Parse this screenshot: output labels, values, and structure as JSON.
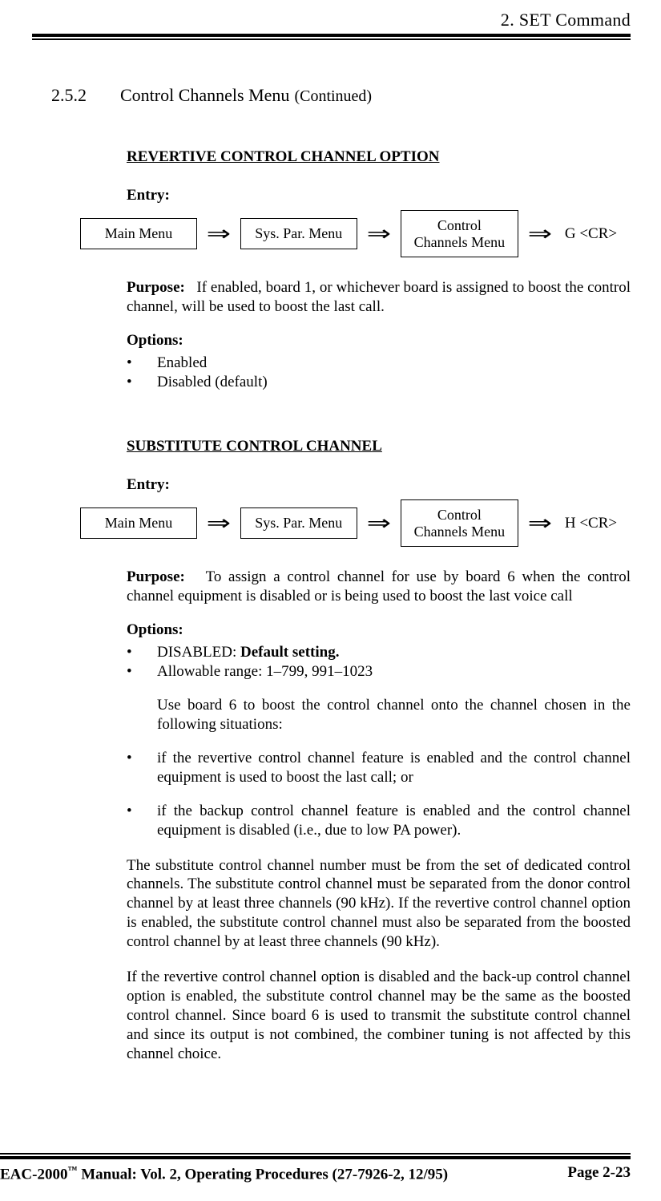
{
  "header": {
    "chapter": "2.   SET Command"
  },
  "section": {
    "number": "2.5.2",
    "title": "Control Channels Menu",
    "continued": "(Continued)"
  },
  "s1": {
    "heading": "REVERTIVE CONTROL CHANNEL OPTION",
    "entry_label": "Entry:",
    "box1": "Main Menu",
    "box2": "Sys. Par. Menu",
    "box3": "Control\nChannels Menu",
    "command": "G <CR>",
    "purpose_label": "Purpose:",
    "purpose_text": "If enabled, board 1, or whichever board is assigned to boost the control channel, will be used to boost the last call.",
    "options_label": "Options:",
    "opt1": "Enabled",
    "opt2": "Disabled (default)"
  },
  "s2": {
    "heading": "SUBSTITUTE CONTROL CHANNEL",
    "entry_label": "Entry:",
    "box1": "Main Menu",
    "box2": "Sys. Par. Menu",
    "box3": "Control\nChannels Menu",
    "command": "H <CR>",
    "purpose_label": "Purpose:",
    "purpose_text": "To assign a control channel for use by board 6 when the control channel equipment is disabled or is being used to boost the last voice call",
    "options_label": "Options:",
    "opt1_prefix": "DISABLED:  ",
    "opt1_bold": "Default setting.",
    "opt2": "Allowable range:  1–799, 991–1023",
    "opt_note": "Use board 6 to boost the control channel onto the channel chosen in the following situations:",
    "opt3": "if the revertive control channel feature is enabled and the control channel equipment is used to boost the last call; or",
    "opt4": "if the backup control channel feature is enabled and the control channel equipment is disabled (i.e., due to low PA power).",
    "para1": "The substitute control channel number must be from the set of dedicated control channels.  The substitute control channel must be separated from the donor control channel by at least three channels (90 kHz).  If the revertive control channel option is enabled, the substitute control channel must also be separated from the boosted control channel by at least three channels (90 kHz).",
    "para2": "If the revertive control channel option is disabled and the back-up control channel option is enabled, the substitute control channel may be the same as the boosted control channel.  Since board 6 is used to transmit the substitute control channel and since its output is not combined, the combiner tuning is not affected by this channel choice."
  },
  "footer": {
    "left_1": "EAC-2000",
    "left_2": " Manual:  Vol. 2, Operating Procedures (27-7926-2, 12/95)",
    "right": "Page 2-23"
  },
  "arrow": "⇒",
  "bullet": "•"
}
